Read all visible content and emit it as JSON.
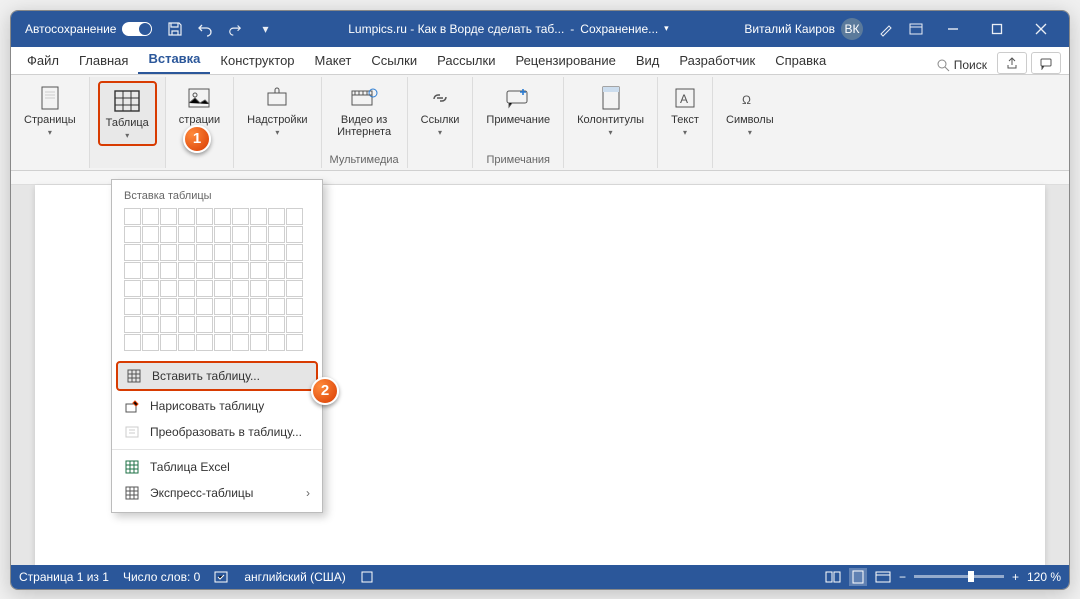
{
  "titlebar": {
    "autosave_label": "Автосохранение",
    "doc_title": "Lumpics.ru - Как в Ворде сделать таб...",
    "save_status": "Сохранение...",
    "user_name": "Виталий Каиров",
    "user_initials": "ВК"
  },
  "tabs": {
    "items": [
      "Файл",
      "Главная",
      "Вставка",
      "Конструктор",
      "Макет",
      "Ссылки",
      "Рассылки",
      "Рецензирование",
      "Вид",
      "Разработчик",
      "Справка"
    ],
    "active_index": 2,
    "search_placeholder": "Поиск"
  },
  "ribbon": {
    "pages": {
      "label": "Страницы"
    },
    "table": {
      "label": "Таблица"
    },
    "illustrations": {
      "label": "страции"
    },
    "addins": {
      "label": "Надстройки"
    },
    "video": {
      "label": "Видео из\nИнтернета",
      "group": "Мультимедиа"
    },
    "links": {
      "label": "Ссылки"
    },
    "comment": {
      "label": "Примечание",
      "group": "Примечания"
    },
    "headers": {
      "label": "Колонтитулы"
    },
    "text": {
      "label": "Текст"
    },
    "symbols": {
      "label": "Символы"
    }
  },
  "dropdown": {
    "title": "Вставка таблицы",
    "items": [
      {
        "label": "Вставить таблицу...",
        "hl": true,
        "ic": "grid"
      },
      {
        "label": "Нарисовать таблицу",
        "ic": "pencil"
      },
      {
        "label": "Преобразовать в таблицу...",
        "disabled": true,
        "ic": "convert"
      },
      {
        "label": "Таблица Excel",
        "ic": "excel"
      },
      {
        "label": "Экспресс-таблицы",
        "arrow": true,
        "ic": "grid"
      }
    ]
  },
  "statusbar": {
    "page": "Страница 1 из 1",
    "words": "Число слов: 0",
    "lang": "английский (США)",
    "zoom": "120 %"
  },
  "badges": {
    "b1": "1",
    "b2": "2"
  }
}
